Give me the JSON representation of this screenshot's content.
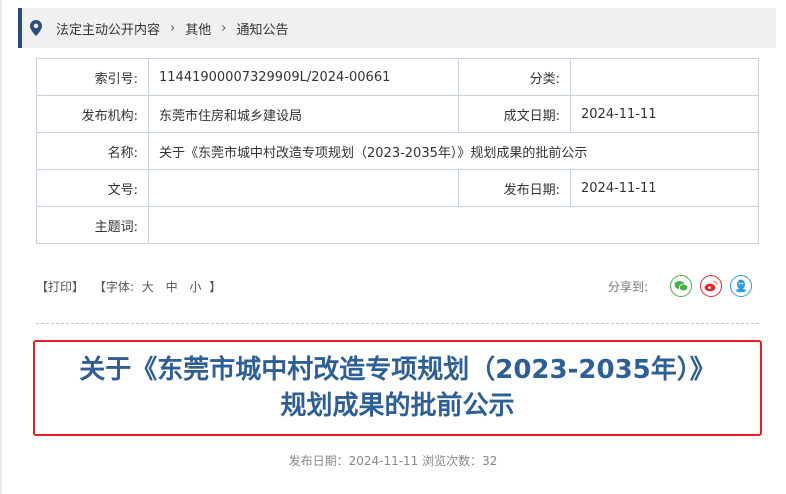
{
  "breadcrumb": {
    "items": [
      "法定主动公开内容",
      "其他",
      "通知公告"
    ]
  },
  "meta": {
    "index_label": "索引号:",
    "index_value": "11441900007329909L/2024-00661",
    "category_label": "分类:",
    "category_value": "",
    "publisher_label": "发布机构:",
    "publisher_value": "东莞市住房和城乡建设局",
    "created_label": "成文日期:",
    "created_value": "2024-11-11",
    "name_label": "名称:",
    "name_value": "关于《东莞市城中村改造专项规划（2023-2035年）》规划成果的批前公示",
    "docno_label": "文号:",
    "docno_value": "",
    "pubdate_label": "发布日期:",
    "pubdate_value": "2024-11-11",
    "keywords_label": "主题词:",
    "keywords_value": ""
  },
  "tools": {
    "print": "【打印】",
    "font_prefix": "【字体:",
    "size_large": "大",
    "size_medium": "中",
    "size_small": "小",
    "font_suffix": "】",
    "share_label": "分享到:",
    "share_icons": [
      "wechat-icon",
      "weibo-icon",
      "qq-icon"
    ],
    "share_colors": {
      "wechat": "#47b347",
      "weibo": "#e6262c",
      "qq": "#2f9be0"
    }
  },
  "article": {
    "title_line1": "关于《东莞市城中村改造专项规划（2023-2035年）》",
    "title_line2": "规划成果的批前公示",
    "pub_info": "发布日期：2024-11-11  浏览次数：32"
  },
  "colors": {
    "accent": "#2a4d80",
    "title": "#2e5f96",
    "highlight_border": "#e32424"
  }
}
